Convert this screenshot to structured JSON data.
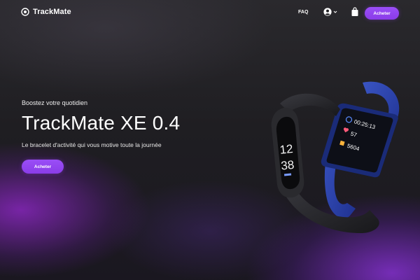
{
  "header": {
    "brand": "TrackMate",
    "nav_faq": "FAQ",
    "cta_label": "Acheter"
  },
  "hero": {
    "eyebrow": "Boostez votre quotidien",
    "title": "TrackMate XE 0.4",
    "subtitle": "Le bracelet d'activité qui vous motive toute la journée",
    "cta_label": "Acheter"
  },
  "product_image": {
    "black_band_time_hours": "12",
    "black_band_time_minutes": "38",
    "blue_band_timer": "00:25:13",
    "blue_band_heart_rate": "57",
    "blue_band_steps": "5604"
  },
  "colors": {
    "accent": "#9244f1",
    "background": "#1d1c20",
    "glow": "#8c32dc",
    "band_blue": "#2d45a8",
    "band_black": "#2a2a2e"
  },
  "icons": [
    "logo-icon",
    "user-icon",
    "chevron-down-icon",
    "cart-icon"
  ]
}
